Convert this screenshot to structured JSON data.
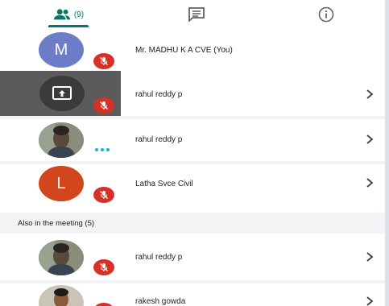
{
  "tabs": {
    "people": {
      "icon": "people-icon",
      "count": "(9)"
    },
    "chat": {
      "icon": "chat-icon"
    },
    "info": {
      "icon": "info-icon"
    }
  },
  "colors": {
    "accent": "#00796b",
    "mute_red": "#d93025",
    "avatar_purple": "#6d7cc6",
    "avatar_orange": "#d2461d",
    "speaking_teal": "#12b5cb"
  },
  "participants": [
    {
      "name": "Mr. MADHU K A CVE (You)",
      "avatar_letter": "M",
      "muted": true
    },
    {
      "name": "rahul reddy p",
      "presenting": true,
      "muted": true
    },
    {
      "name": "rahul reddy p",
      "speaking": true
    },
    {
      "name": "Latha Svce Civil",
      "avatar_letter": "L",
      "muted": true
    }
  ],
  "section": {
    "also_in_meeting": "Also in the meeting (5)"
  },
  "others": [
    {
      "name": "rahul reddy p",
      "muted": true
    },
    {
      "name": "rakesh gowda",
      "muted": true
    }
  ]
}
